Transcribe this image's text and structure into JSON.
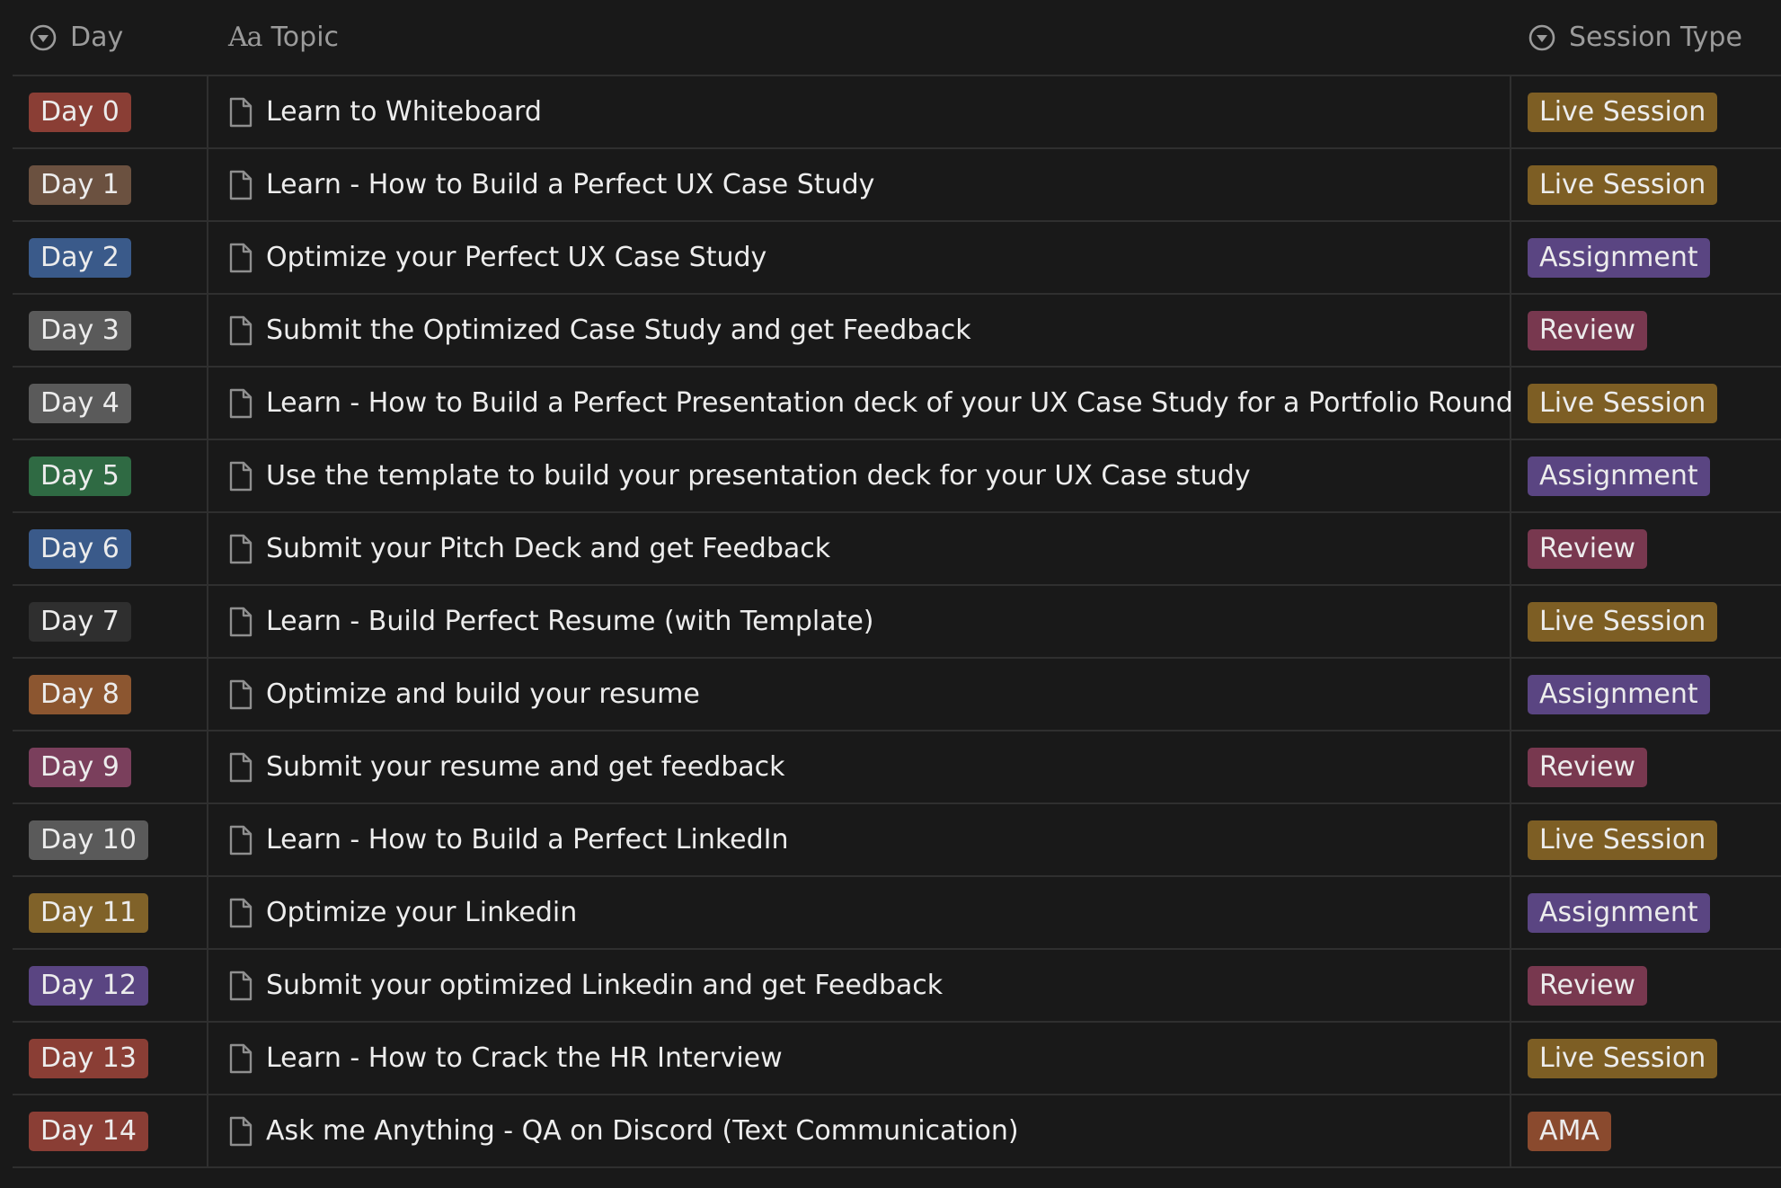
{
  "header": {
    "day_label": "Day",
    "topic_label": "Topic",
    "topic_icon_text": "Aa",
    "type_label": "Session Type"
  },
  "colors": {
    "red": "#8a3e35",
    "brown": "#6b5140",
    "blue": "#3a5a8a",
    "gray": "#5a5a5a",
    "green": "#2f6a43",
    "dark": "#2f2f2f",
    "orange": "#8c5630",
    "pink": "#7a3f5c",
    "yellow": "#806229",
    "purple": "#5a4582",
    "live": "#7d5e24",
    "assignment": "#5a4582",
    "review": "#78384f",
    "ama": "#8a4a2e"
  },
  "rows": [
    {
      "day": "Day 0",
      "day_color": "red",
      "topic": "Learn to Whiteboard",
      "type": "Live Session",
      "type_color": "live"
    },
    {
      "day": "Day 1",
      "day_color": "brown",
      "topic": "Learn - How to Build a Perfect UX Case Study",
      "type": "Live Session",
      "type_color": "live"
    },
    {
      "day": "Day 2",
      "day_color": "blue",
      "topic": "Optimize your Perfect UX Case Study",
      "type": "Assignment",
      "type_color": "assignment"
    },
    {
      "day": "Day 3",
      "day_color": "gray",
      "topic": "Submit the Optimized Case Study and get Feedback",
      "type": "Review",
      "type_color": "review"
    },
    {
      "day": "Day 4",
      "day_color": "gray",
      "topic": "Learn - How to Build a Perfect Presentation deck of your UX Case Study for a Portfolio Round",
      "type": "Live Session",
      "type_color": "live"
    },
    {
      "day": "Day 5",
      "day_color": "green",
      "topic": "Use the template to build your presentation deck for your UX Case study",
      "type": "Assignment",
      "type_color": "assignment"
    },
    {
      "day": "Day 6",
      "day_color": "blue",
      "topic": "Submit your Pitch Deck and get Feedback",
      "type": "Review",
      "type_color": "review"
    },
    {
      "day": "Day 7",
      "day_color": "dark",
      "topic": "Learn - Build Perfect Resume (with Template)",
      "type": "Live Session",
      "type_color": "live"
    },
    {
      "day": "Day 8",
      "day_color": "orange",
      "topic": "Optimize and build your resume",
      "type": "Assignment",
      "type_color": "assignment"
    },
    {
      "day": "Day 9",
      "day_color": "pink",
      "topic": "Submit your resume and get feedback",
      "type": "Review",
      "type_color": "review"
    },
    {
      "day": "Day 10",
      "day_color": "gray",
      "topic": "Learn - How to Build a Perfect LinkedIn",
      "type": "Live Session",
      "type_color": "live"
    },
    {
      "day": "Day 11",
      "day_color": "yellow",
      "topic": "Optimize your Linkedin",
      "type": "Assignment",
      "type_color": "assignment"
    },
    {
      "day": "Day 12",
      "day_color": "purple",
      "topic": "Submit your optimized Linkedin and get Feedback",
      "type": "Review",
      "type_color": "review"
    },
    {
      "day": "Day 13",
      "day_color": "red",
      "topic": "Learn - How to Crack the HR Interview",
      "type": "Live Session",
      "type_color": "live"
    },
    {
      "day": "Day 14",
      "day_color": "red",
      "topic": "Ask me Anything - QA on Discord (Text Communication)",
      "type": "AMA",
      "type_color": "ama"
    }
  ]
}
